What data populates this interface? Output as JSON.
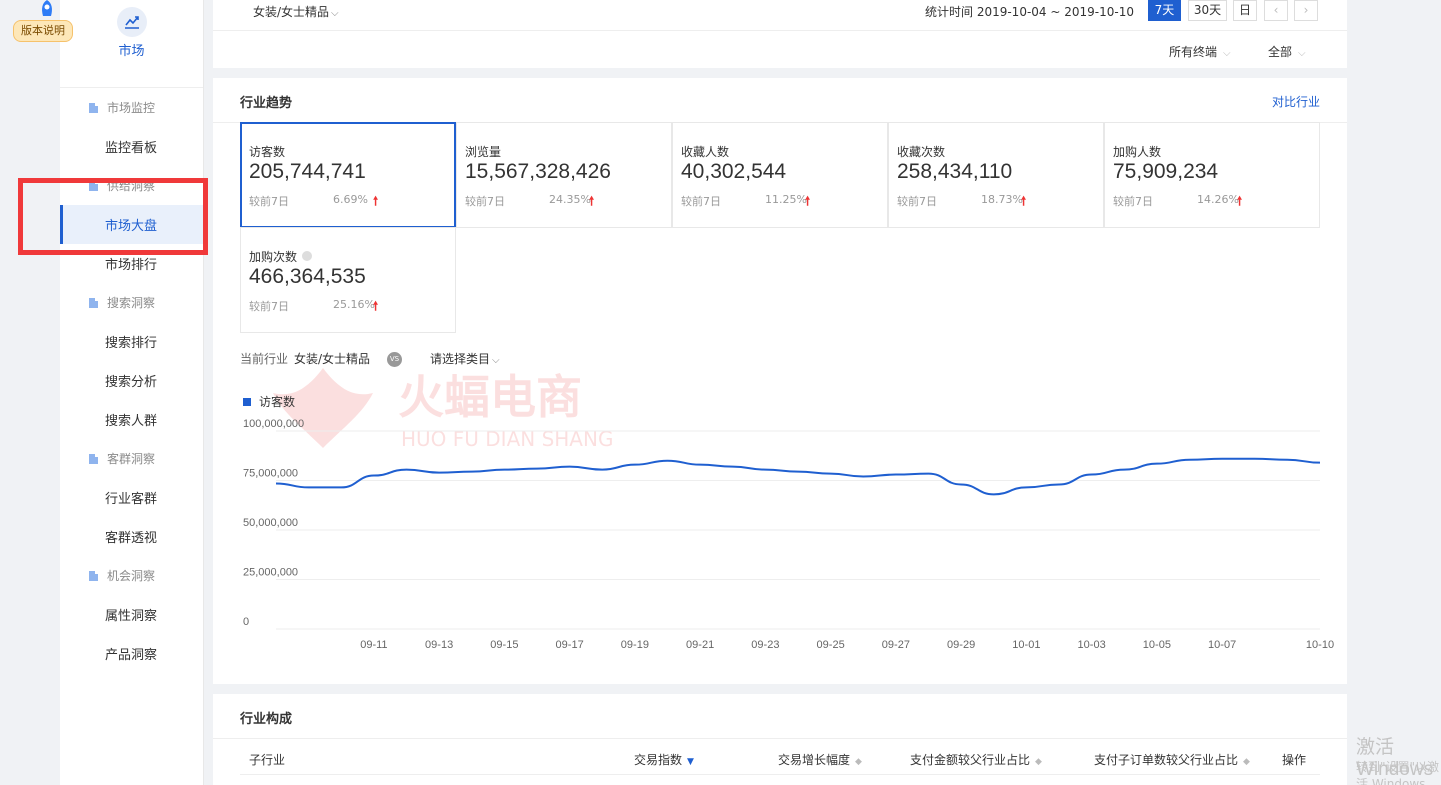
{
  "badge": {
    "label": "版本说明"
  },
  "sidebar": {
    "top_label": "市场",
    "groups": [
      {
        "label": "市场监控",
        "items": [
          "监控看板"
        ]
      },
      {
        "label": "供给洞察",
        "items": [
          "市场大盘",
          "市场排行"
        ]
      },
      {
        "label": "搜索洞察",
        "items": [
          "搜索排行",
          "搜索分析",
          "搜索人群"
        ]
      },
      {
        "label": "客群洞察",
        "items": [
          "行业客群",
          "客群透视"
        ]
      },
      {
        "label": "机会洞察",
        "items": [
          "属性洞察",
          "产品洞察"
        ]
      }
    ],
    "active_item": "市场大盘"
  },
  "topbar": {
    "breadcrumb": "女装/女士精品",
    "date_range": "统计时间 2019-10-04 ~ 2019-10-10",
    "periods": [
      "7天",
      "30天",
      "日"
    ],
    "active_period": "7天",
    "terminal_select": "所有终端",
    "all_select": "全部"
  },
  "trend": {
    "title": "行业趋势",
    "compare_link": "对比行业",
    "metrics": [
      {
        "label": "访客数",
        "value": "205,744,741",
        "cmp": "较前7日",
        "pct": "6.69%",
        "up": true,
        "selected": true
      },
      {
        "label": "浏览量",
        "value": "15,567,328,426",
        "cmp": "较前7日",
        "pct": "24.35%",
        "up": true
      },
      {
        "label": "收藏人数",
        "value": "40,302,544",
        "cmp": "较前7日",
        "pct": "11.25%",
        "up": true
      },
      {
        "label": "收藏次数",
        "value": "258,434,110",
        "cmp": "较前7日",
        "pct": "18.73%",
        "up": true
      },
      {
        "label": "加购人数",
        "value": "75,909,234",
        "cmp": "较前7日",
        "pct": "14.26%",
        "up": true
      },
      {
        "label": "加购次数",
        "value": "466,364,535",
        "cmp": "较前7日",
        "pct": "25.16%",
        "up": true
      }
    ],
    "current_industry_label": "当前行业",
    "current_industry": "女装/女士精品",
    "vs": "VS",
    "category_select": "请选择类目"
  },
  "watermark": {
    "cn": "火蝠电商",
    "en": "HUO FU DIAN SHANG"
  },
  "chart_data": {
    "type": "line",
    "series": [
      {
        "name": "访客数",
        "color": "#1f5fd0",
        "values": [
          73500000,
          71500000,
          71500000,
          77500000,
          80500000,
          79000000,
          79500000,
          80500000,
          81000000,
          82000000,
          80500000,
          83000000,
          85000000,
          83000000,
          82000000,
          80500000,
          79500000,
          78500000,
          77000000,
          78000000,
          78500000,
          73000000,
          68000000,
          71500000,
          73000000,
          78000000,
          80500000,
          83500000,
          85500000,
          86000000,
          86000000,
          85500000,
          84000000
        ]
      }
    ],
    "x": [
      "09-08",
      "09-09",
      "09-10",
      "09-11",
      "09-12",
      "09-13",
      "09-14",
      "09-15",
      "09-16",
      "09-17",
      "09-18",
      "09-19",
      "09-20",
      "09-21",
      "09-22",
      "09-23",
      "09-24",
      "09-25",
      "09-26",
      "09-27",
      "09-28",
      "09-29",
      "09-30",
      "10-01",
      "10-02",
      "10-03",
      "10-04",
      "10-05",
      "10-06",
      "10-07",
      "10-08",
      "10-09",
      "10-10"
    ],
    "tick_labels": [
      "09-11",
      "09-13",
      "09-15",
      "09-17",
      "09-19",
      "09-21",
      "09-23",
      "09-25",
      "09-27",
      "09-29",
      "10-01",
      "10-03",
      "10-05",
      "10-07",
      "10-10"
    ],
    "y_ticks": [
      "100,000,000",
      "75,000,000",
      "50,000,000",
      "25,000,000",
      "0"
    ],
    "ylim": [
      0,
      100000000
    ],
    "grid": true,
    "legend": "top-left"
  },
  "composition": {
    "title": "行业构成",
    "headers": [
      "子行业",
      "交易指数",
      "交易增长幅度",
      "支付金额较父行业占比",
      "支付子订单数较父行业占比",
      "操作"
    ]
  },
  "windows": {
    "line1": "激活 Windows",
    "line2": "转到\"设置\"以激活 Windows。"
  }
}
